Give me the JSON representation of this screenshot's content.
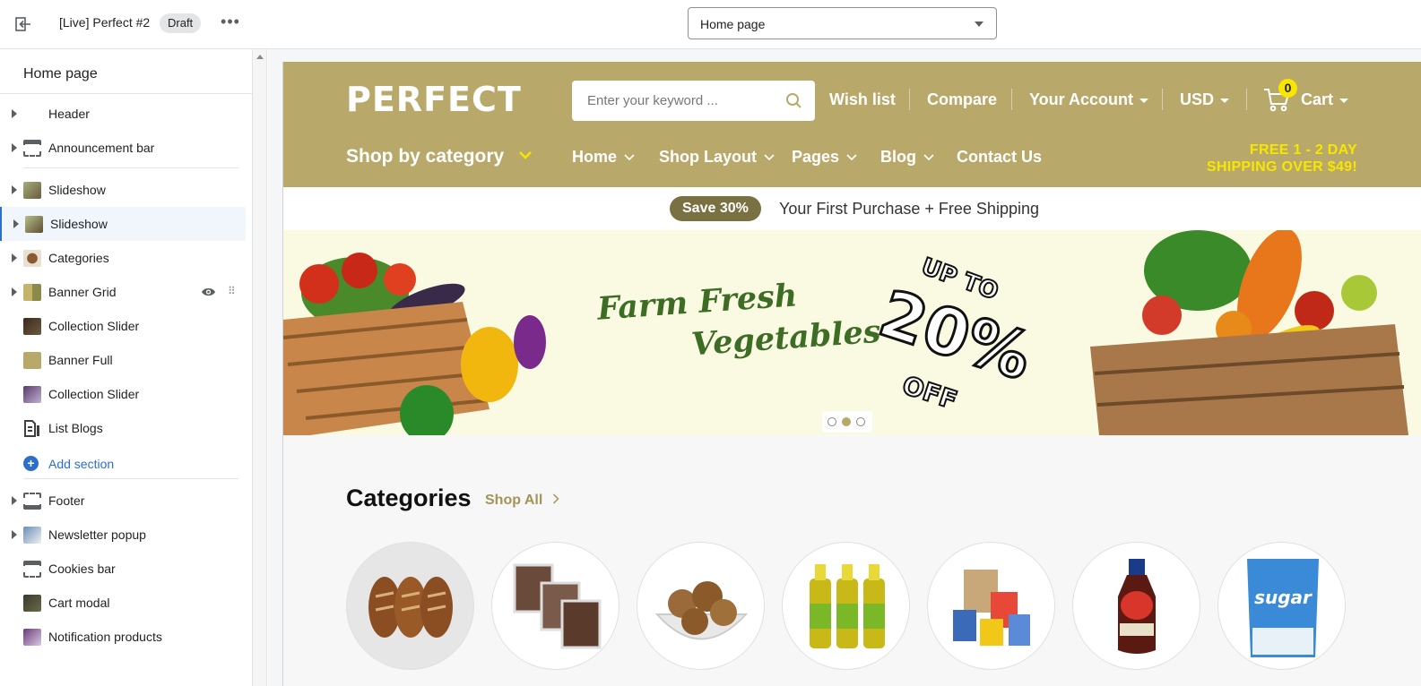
{
  "topbar": {
    "theme_name": "[Live] Perfect #2",
    "status_badge": "Draft",
    "more_label": "•••",
    "page_selector": "Home page"
  },
  "sidebar": {
    "title": "Home page",
    "header_items": [
      {
        "label": "Header"
      },
      {
        "label": "Announcement bar"
      }
    ],
    "template_items": [
      {
        "label": "Slideshow"
      },
      {
        "label": "Slideshow"
      },
      {
        "label": "Categories"
      },
      {
        "label": "Banner Grid"
      },
      {
        "label": "Collection Slider"
      },
      {
        "label": "Banner Full"
      },
      {
        "label": "Collection Slider"
      },
      {
        "label": "List Blogs"
      }
    ],
    "add_section": "Add section",
    "footer_items": [
      {
        "label": "Footer"
      },
      {
        "label": "Newsletter popup"
      },
      {
        "label": "Cookies bar"
      },
      {
        "label": "Cart modal"
      },
      {
        "label": "Notification products"
      }
    ],
    "accent_color": "#2c6ecb"
  },
  "store": {
    "logo": "PERFECT",
    "search_placeholder": "Enter your keyword ...",
    "wish_list": "Wish list",
    "compare": "Compare",
    "account": "Your Account",
    "currency": "USD",
    "cart_label": "Cart",
    "cart_count": "0",
    "shop_by_category": "Shop by category",
    "nav": [
      "Home",
      "Shop Layout",
      "Pages",
      "Blog",
      "Contact Us"
    ],
    "free_shipping_line1": "FREE 1 - 2 DAY",
    "free_shipping_line2": "SHIPPING OVER $49!",
    "brand_color": "#b8a96b",
    "highlight_color": "#f7e700"
  },
  "announcement": {
    "badge": "Save 30%",
    "text": "Your First Purchase + Free Shipping"
  },
  "slideshow": {
    "headline_line1": "Farm Fresh",
    "headline_line2": "Vegetables",
    "promo_top": "UP TO",
    "promo_value": "20%",
    "promo_bottom": "OFF",
    "active_slide": 2,
    "slide_count": 3
  },
  "categories": {
    "title": "Categories",
    "shop_all": "Shop All",
    "item_count": 7
  }
}
